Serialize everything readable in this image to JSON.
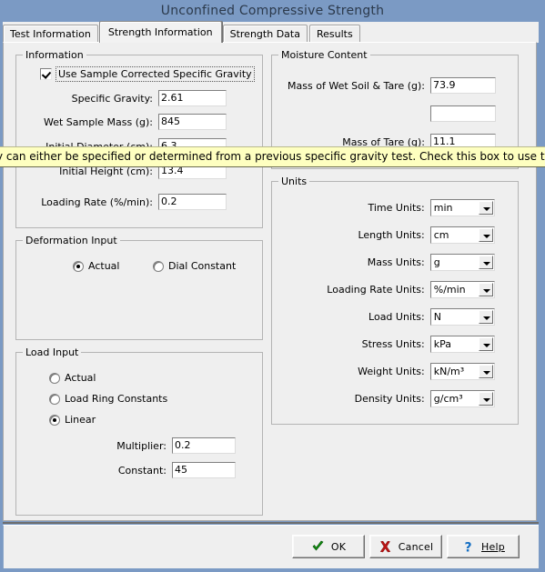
{
  "window": {
    "title": "Unconfined Compressive Strength",
    "titlebar_color": "#7b9ac4",
    "face_color": "#efefef"
  },
  "tabs": [
    {
      "label": "Test Information",
      "active": false
    },
    {
      "label": "Strength Information",
      "active": true
    },
    {
      "label": "Strength Data",
      "active": false
    },
    {
      "label": "Results",
      "active": false
    }
  ],
  "tooltip": {
    "text": "y can either be specified or determined from a previous specific gravity test. Check this box to use the specific gra",
    "background": "#feffc0"
  },
  "information": {
    "title": "Information",
    "checkbox": {
      "label": "Use Sample Corrected Specific Gravity",
      "checked": true
    },
    "specific_gravity": {
      "label": "Specific Gravity:",
      "value": "2.61"
    },
    "fields": [
      {
        "label": "Wet Sample Mass (g):",
        "value": "845"
      },
      {
        "label": "Initial Diameter (cm):",
        "value": "6.3"
      },
      {
        "label": "Initial Height (cm):",
        "value": "13.4"
      },
      {
        "label": "Loading Rate (%/min):",
        "value": "0.2"
      }
    ]
  },
  "deformation_input": {
    "title": "Deformation Input",
    "options": [
      {
        "label": "Actual",
        "selected": true
      },
      {
        "label": "Dial Constant",
        "selected": false
      }
    ]
  },
  "load_input": {
    "title": "Load Input",
    "options": [
      {
        "label": "Actual",
        "selected": false
      },
      {
        "label": "Load Ring Constants",
        "selected": false
      },
      {
        "label": "Linear",
        "selected": true
      }
    ],
    "fields": [
      {
        "label": "Multiplier:",
        "value": "0.2"
      },
      {
        "label": "Constant:",
        "value": "45"
      }
    ]
  },
  "moisture_content": {
    "title": "Moisture Content",
    "fields": [
      {
        "label": "Mass of Wet Soil & Tare (g):",
        "value": "73.9"
      },
      {
        "label": "Mass of Tare (g):",
        "value": "11.1"
      }
    ]
  },
  "units": {
    "title": "Units",
    "fields": [
      {
        "label": "Time Units:",
        "value": "min"
      },
      {
        "label": "Length Units:",
        "value": "cm"
      },
      {
        "label": "Mass Units:",
        "value": "g"
      },
      {
        "label": "Loading Rate Units:",
        "value": "%/min"
      },
      {
        "label": "Load Units:",
        "value": "N"
      },
      {
        "label": "Stress Units:",
        "value": "kPa"
      },
      {
        "label": "Weight Units:",
        "value": "kN/m³"
      },
      {
        "label": "Density Units:",
        "value": "g/cm³"
      }
    ]
  },
  "buttons": {
    "ok": {
      "label": "OK",
      "icon": "check-icon",
      "color": "#1a8a1a"
    },
    "cancel": {
      "label": "Cancel",
      "icon": "x-icon",
      "color": "#bb1414"
    },
    "help": {
      "label": "Help",
      "icon": "question-icon",
      "color": "#1770c4"
    }
  }
}
